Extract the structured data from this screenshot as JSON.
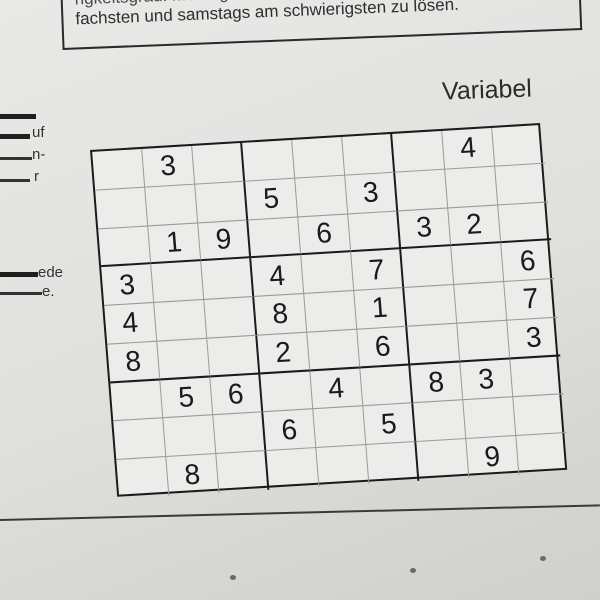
{
  "header_text": {
    "line1": "rigkeitsgrad. Montag",
    "line2": "fachsten und samstags am schwierigsten zu lösen."
  },
  "left_fragments": [
    "uf",
    "n-",
    "r",
    "ede",
    "e."
  ],
  "difficulty_label": "Variabel",
  "sudoku": {
    "rows": [
      [
        "",
        "3",
        "",
        "",
        "",
        "",
        "",
        "4",
        ""
      ],
      [
        "",
        "",
        "",
        "5",
        "",
        "3",
        "",
        "",
        ""
      ],
      [
        "",
        "1",
        "9",
        "",
        "6",
        "",
        "3",
        "2",
        ""
      ],
      [
        "3",
        "",
        "",
        "4",
        "",
        "7",
        "",
        "",
        "6"
      ],
      [
        "4",
        "",
        "",
        "8",
        "",
        "1",
        "",
        "",
        "7"
      ],
      [
        "8",
        "",
        "",
        "2",
        "",
        "6",
        "",
        "",
        "3"
      ],
      [
        "",
        "5",
        "6",
        "",
        "4",
        "",
        "8",
        "3",
        ""
      ],
      [
        "",
        "",
        "",
        "6",
        "",
        "5",
        "",
        "",
        ""
      ],
      [
        "",
        "8",
        "",
        "",
        "",
        "",
        "",
        "9",
        ""
      ]
    ]
  }
}
